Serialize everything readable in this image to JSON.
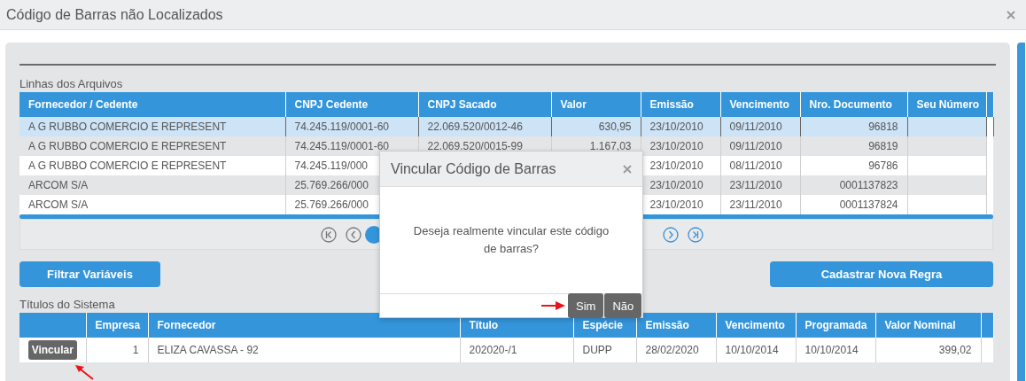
{
  "window": {
    "title": "Código de Barras não Localizados"
  },
  "files_table": {
    "title": "Linhas dos Arquivos",
    "columns": [
      "Fornecedor / Cedente",
      "CNPJ Cedente",
      "CNPJ Sacado",
      "Valor",
      "Emissão",
      "Vencimento",
      "Nro. Documento",
      "Seu Número"
    ],
    "rows": [
      {
        "selected": true,
        "cells": [
          "A G RUBBO COMERCIO E REPRESENT",
          "74.245.119/0001-60",
          "22.069.520/0012-46",
          "630,95",
          "23/10/2010",
          "09/11/2010",
          "96818",
          null
        ]
      },
      {
        "selected": false,
        "cells": [
          "A G RUBBO COMERCIO E REPRESENT",
          "74.245.119/0001-60",
          "22.069.520/0015-99",
          "1.167,03",
          "23/10/2010",
          "09/11/2010",
          "96819",
          null
        ]
      },
      {
        "selected": false,
        "cells": [
          "A G RUBBO COMERCIO E REPRESENT",
          "74.245.119/000",
          null,
          null,
          "23/10/2010",
          "08/11/2010",
          "96786",
          null
        ]
      },
      {
        "selected": false,
        "cells": [
          "ARCOM S/A",
          "25.769.266/000",
          null,
          null,
          "23/10/2010",
          "23/11/2010",
          "0001137823",
          null
        ]
      },
      {
        "selected": false,
        "cells": [
          "ARCOM S/A",
          "25.769.266/000",
          null,
          null,
          "23/10/2010",
          "23/11/2010",
          "0001137824",
          null
        ]
      }
    ]
  },
  "actions": [
    "Filtrar Variáveis",
    "Cadastrar Nova Regra"
  ],
  "system_table": {
    "title": "Títulos do Sistema",
    "columns": [
      "Empresa",
      "Fornecedor",
      "Título",
      "Espécie",
      "Emissão",
      "Vencimento",
      "Programada",
      "Valor Nominal"
    ],
    "rows": [
      {
        "action": "Vincular",
        "cells": [
          "1",
          "ELIZA CAVASSA - 92",
          "202020-/1",
          "DUPP",
          "28/02/2020",
          "10/10/2014",
          "10/10/2014",
          "399,02"
        ]
      }
    ]
  },
  "dialog": {
    "title": "Vincular Código de Barras",
    "message": "Deseja realmente vincular este código de barras?",
    "buttons": [
      "Sim",
      "Não"
    ]
  }
}
